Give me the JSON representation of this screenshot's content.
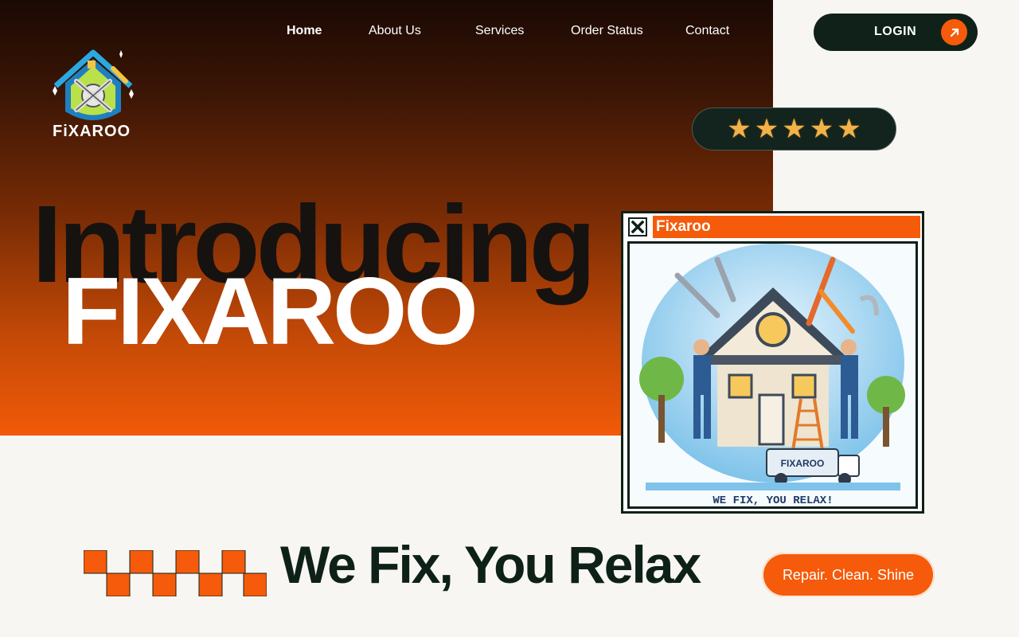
{
  "nav": {
    "items": [
      {
        "label": "Home",
        "active": true
      },
      {
        "label": "About Us"
      },
      {
        "label": "Services"
      },
      {
        "label": "Order Status"
      },
      {
        "label": "Contact"
      }
    ]
  },
  "login": {
    "label": "LOGIN",
    "icon": "arrow-up-right-icon"
  },
  "logo": {
    "text": "FiXAROO",
    "icon": "house-tools-logo"
  },
  "rating": {
    "stars": 5,
    "max": 5
  },
  "hero": {
    "intro": "Introducing",
    "brand": "FIXAROO"
  },
  "window": {
    "title": "Fixaroo",
    "image": {
      "truck_label": "FIXAROO",
      "caption": "WE FIX, YOU RELAX!"
    }
  },
  "tagline": {
    "slogan": "We Fix, You Relax",
    "pill": "Repair. Clean. Shine"
  },
  "colors": {
    "accent": "#f55b0a",
    "dark": "#0e2119",
    "background": "#f8f6f2"
  }
}
